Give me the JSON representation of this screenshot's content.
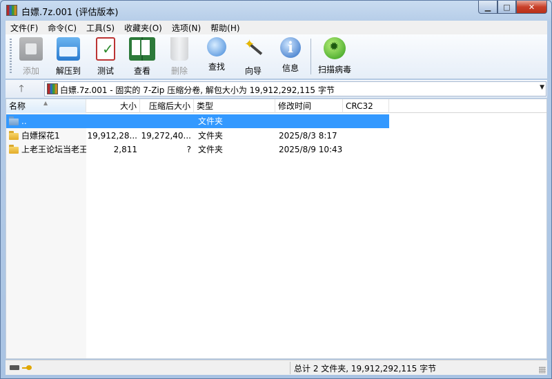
{
  "window": {
    "title": "白嫖.7z.001 (评估版本)"
  },
  "menu": [
    "文件(F)",
    "命令(C)",
    "工具(S)",
    "收藏夹(O)",
    "选项(N)",
    "帮助(H)"
  ],
  "toolbar": {
    "add": "添加",
    "extract": "解压到",
    "test": "测试",
    "view": "查看",
    "delete": "删除",
    "find": "查找",
    "wizard": "向导",
    "info": "信息",
    "virus_scan": "扫描病毒"
  },
  "address": {
    "text": "白嫖.7z.001 - 固实的 7-Zip 压缩分卷, 解包大小为 19,912,292,115 字节"
  },
  "columns": {
    "name": "名称",
    "size": "大小",
    "packed": "压缩后大小",
    "type": "类型",
    "modified": "修改时间",
    "crc": "CRC32"
  },
  "files": [
    {
      "name": "..",
      "size": "",
      "packed": "",
      "type": "文件夹",
      "modified": "",
      "crc": ""
    },
    {
      "name": "白嫖探花1",
      "size": "19,912,28...",
      "packed": "19,272,40...",
      "type": "文件夹",
      "modified": "2025/8/3 8:17",
      "crc": ""
    },
    {
      "name": "上老王论坛当老王",
      "size": "2,811",
      "packed": "?",
      "type": "文件夹",
      "modified": "2025/8/9 10:43",
      "crc": ""
    }
  ],
  "status": {
    "summary": "总计 2 文件夹, 19,912,292,115 字节"
  },
  "colors": {
    "selection": "#3399ff",
    "close_button": "#c8402a"
  }
}
